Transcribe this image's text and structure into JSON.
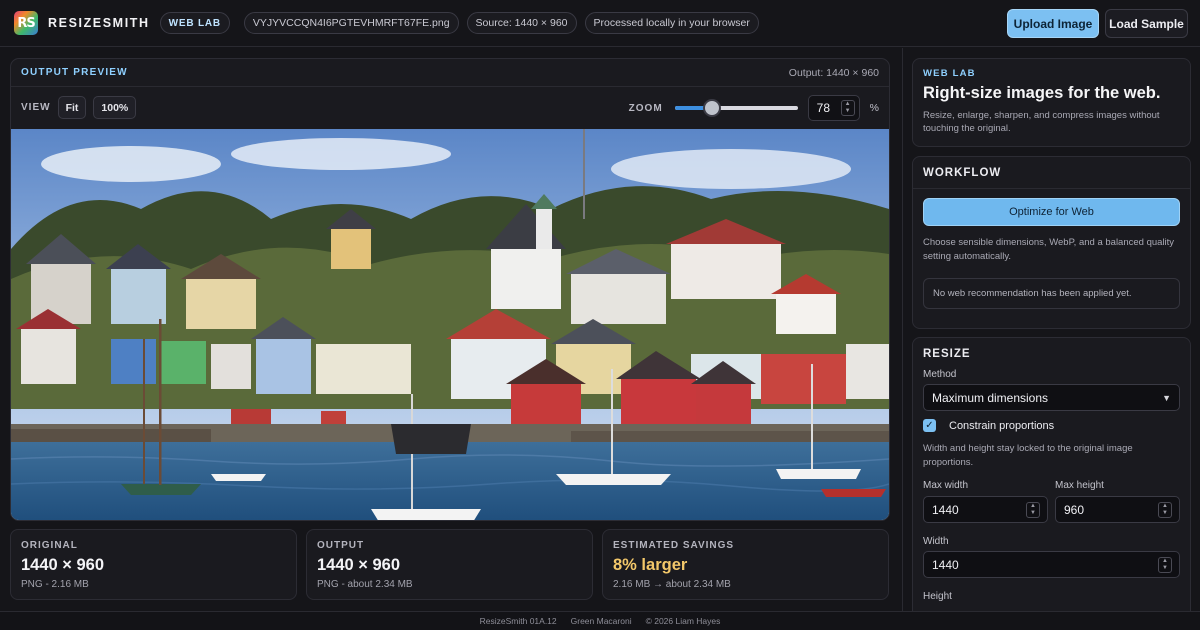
{
  "header": {
    "logo_text": "RS",
    "brand": "RESIZESMITH",
    "badge": "WEB LAB",
    "filename": "VYJYVCCQN4I6PGTEVHMRFT67FE.png",
    "source": "Source: 1440 × 960",
    "processing": "Processed locally in your browser",
    "upload_label": "Upload Image",
    "sample_label": "Load Sample"
  },
  "preview": {
    "title": "OUTPUT PREVIEW",
    "output_size": "Output: 1440 × 960",
    "view_label": "VIEW",
    "fit_label": "Fit",
    "actual_label": "100%",
    "zoom_label": "ZOOM",
    "zoom_value": "78",
    "zoom_fraction": 0.3,
    "zoom_unit": "%"
  },
  "stats": {
    "original": {
      "label": "ORIGINAL",
      "value": "1440 × 960",
      "sub": "PNG - 2.16 MB"
    },
    "output": {
      "label": "OUTPUT",
      "value": "1440 × 960",
      "sub": "PNG - about 2.34 MB"
    },
    "savings": {
      "label": "ESTIMATED SAVINGS",
      "value": "8% larger",
      "sub": "2.16 MB → about 2.34 MB"
    }
  },
  "sidebar": {
    "intro": {
      "eyebrow": "WEB LAB",
      "title": "Right-size images for the web.",
      "description": "Resize, enlarge, sharpen, and compress images without touching the original."
    },
    "workflow": {
      "title": "WORKFLOW",
      "button": "Optimize for Web",
      "description": "Choose sensible dimensions, WebP, and a balanced quality setting automatically.",
      "notice": "No web recommendation has been applied yet."
    },
    "resize": {
      "title": "RESIZE",
      "method_label": "Method",
      "method_value": "Maximum dimensions",
      "constrain_label": "Constrain proportions",
      "constrain_help": "Width and height stay locked to the original image proportions.",
      "max_width_label": "Max width",
      "max_width_value": "1440",
      "max_height_label": "Max height",
      "max_height_value": "960",
      "width_label": "Width",
      "width_value": "1440",
      "height_label": "Height"
    }
  },
  "footer": {
    "version": "ResizeSmith 01A.12",
    "codename": "Green Macaroni",
    "copyright": "© 2026 Liam Hayes"
  },
  "colors": {
    "accent": "#7cc0f2",
    "eyebrow": "#8fd0ff",
    "warning": "#f3c86a",
    "background": "#151519"
  }
}
